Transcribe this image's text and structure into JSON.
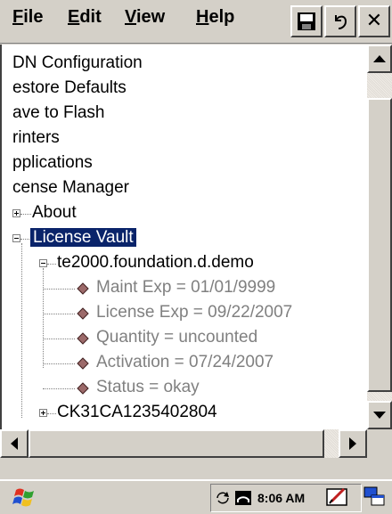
{
  "menu": {
    "file": {
      "underline": "F",
      "rest": "ile"
    },
    "edit": {
      "underline": "E",
      "rest": "dit"
    },
    "view": {
      "underline": "V",
      "rest": "iew"
    },
    "help": {
      "underline": "H",
      "rest": "elp"
    }
  },
  "toolbar": {
    "close_glyph": "✕"
  },
  "tree": {
    "items": [
      "DN Configuration",
      "estore Defaults",
      "ave to Flash",
      "rinters",
      "pplications",
      "cense Manager",
      "About",
      "License Vault",
      "te2000.foundation.d.demo",
      "Maint Exp = 01/01/9999",
      "License Exp = 09/22/2007",
      "Quantity = uncounted",
      "Activation = 07/24/2007",
      "Status = okay",
      "CK31CA1235402804"
    ]
  },
  "taskbar": {
    "time": "8:06 AM"
  },
  "colors": {
    "selection": "#0a246a",
    "chrome": "#d4d0c8"
  }
}
